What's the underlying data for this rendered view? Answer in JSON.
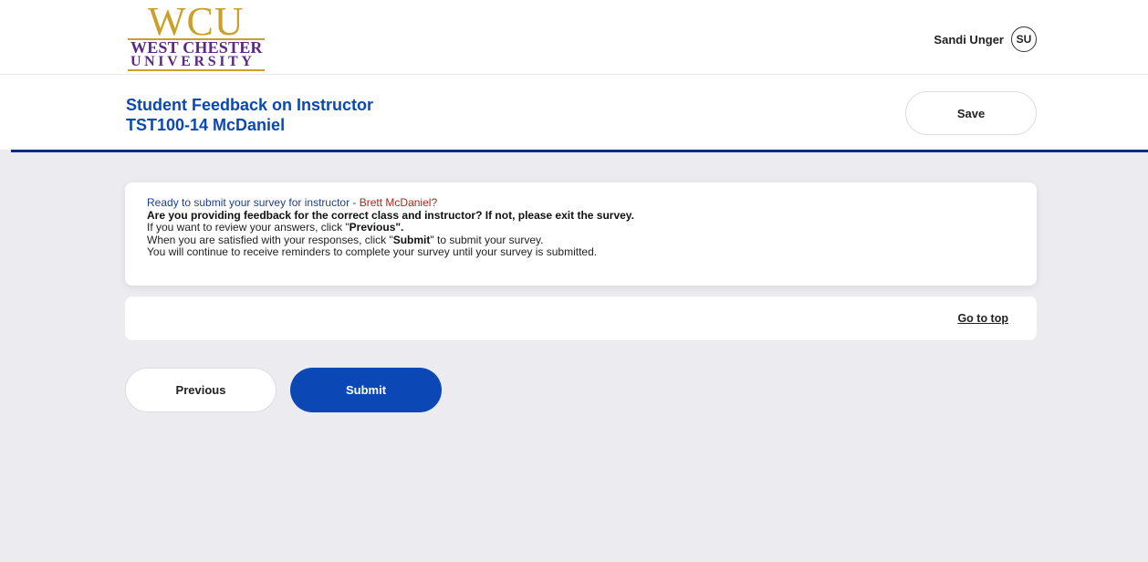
{
  "logo": {
    "top": "WCU",
    "line1": "WEST CHESTER",
    "line2": "UNIVERSITY",
    "colors": {
      "gold": "#c9a12a",
      "purple": "#5b2a82"
    }
  },
  "user": {
    "name": "Sandi Unger",
    "initials": "SU"
  },
  "header": {
    "title": "Student Feedback on Instructor",
    "course": "TST100-14 McDaniel",
    "save_label": "Save"
  },
  "message": {
    "ready_prefix": "Ready to submit your survey for instructor - ",
    "instructor": "Brett McDaniel?",
    "correct_class": "Are you providing feedback for the correct class and instructor? If not, please exit the survey.",
    "review_prefix": "If you want to review your answers, click \"",
    "review_bold": "Previous\".",
    "satisfied_prefix": "When you are satisfied with your responses, click \"",
    "satisfied_bold": "Submit",
    "satisfied_suffix": "\" to submit your survey.",
    "reminder": "You will continue to receive reminders to complete your survey until your survey is submitted."
  },
  "nav": {
    "goto_top": "Go to top"
  },
  "buttons": {
    "previous": "Previous",
    "submit": "Submit"
  },
  "colors": {
    "accent": "#0b48b5",
    "rule": "#0d2a8a",
    "instructor_red": "#b42318",
    "background": "#ebebf0"
  }
}
